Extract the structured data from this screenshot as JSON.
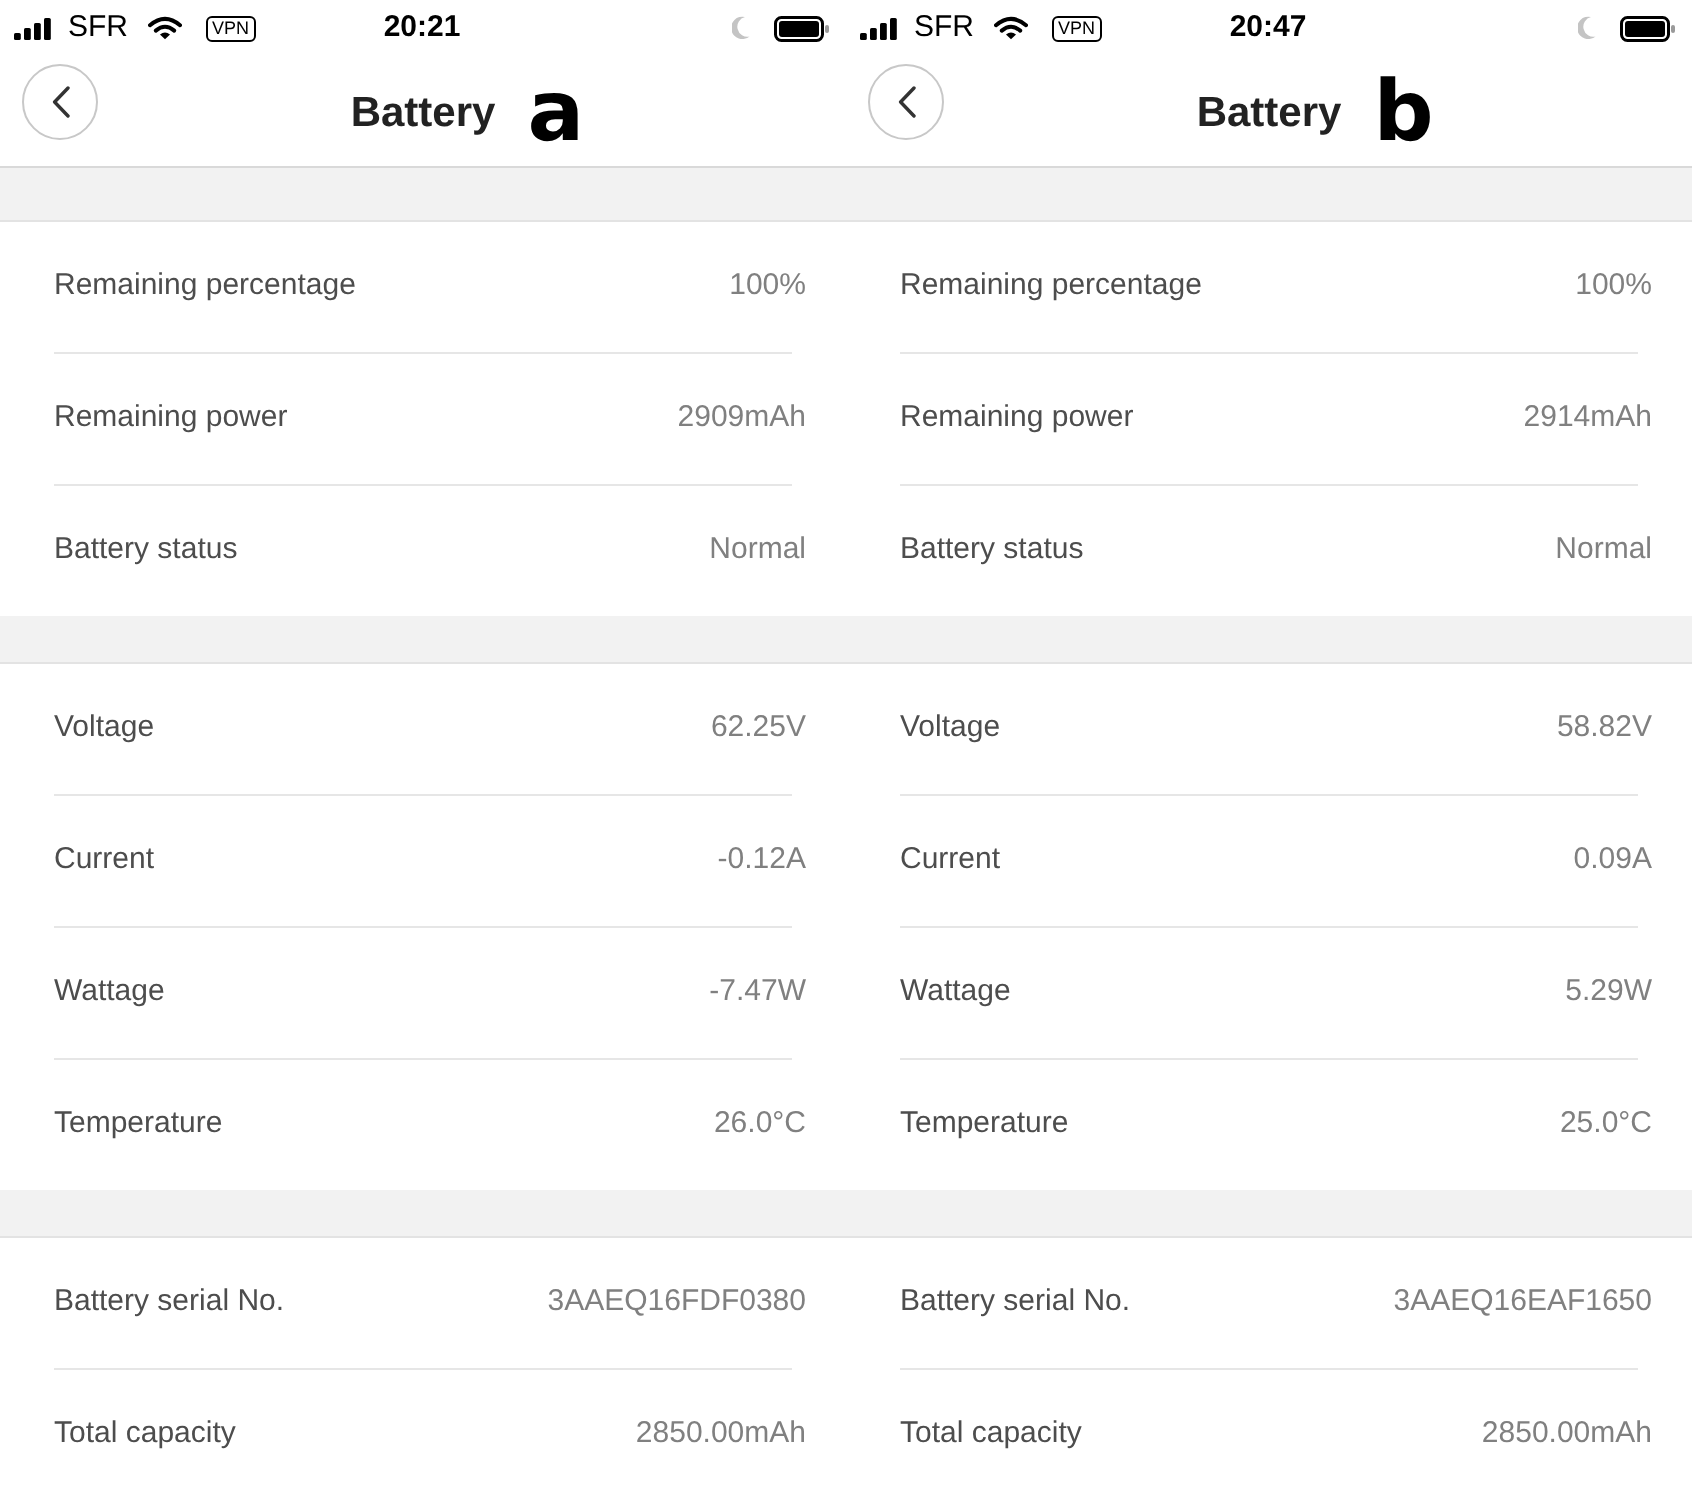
{
  "screens": [
    {
      "status_bar": {
        "carrier": "SFR",
        "vpn": "VPN",
        "time": "20:21"
      },
      "header": {
        "title": "Battery",
        "annotation": "a"
      },
      "groups": [
        {
          "rows": [
            {
              "label": "Remaining percentage",
              "value": "100%"
            },
            {
              "label": "Remaining power",
              "value": "2909mAh"
            },
            {
              "label": "Battery status",
              "value": "Normal"
            }
          ]
        },
        {
          "rows": [
            {
              "label": "Voltage",
              "value": "62.25V"
            },
            {
              "label": "Current",
              "value": "-0.12A"
            },
            {
              "label": "Wattage",
              "value": "-7.47W"
            },
            {
              "label": "Temperature",
              "value": "26.0°C"
            }
          ]
        },
        {
          "rows": [
            {
              "label": "Battery serial No.",
              "value": "3AAEQ16FDF0380"
            },
            {
              "label": "Total capacity",
              "value": "2850.00mAh"
            }
          ]
        }
      ]
    },
    {
      "status_bar": {
        "carrier": "SFR",
        "vpn": "VPN",
        "time": "20:47"
      },
      "header": {
        "title": "Battery",
        "annotation": "b"
      },
      "groups": [
        {
          "rows": [
            {
              "label": "Remaining percentage",
              "value": "100%"
            },
            {
              "label": "Remaining power",
              "value": "2914mAh"
            },
            {
              "label": "Battery status",
              "value": "Normal"
            }
          ]
        },
        {
          "rows": [
            {
              "label": "Voltage",
              "value": "58.82V"
            },
            {
              "label": "Current",
              "value": "0.09A"
            },
            {
              "label": "Wattage",
              "value": "5.29W"
            },
            {
              "label": "Temperature",
              "value": "25.0°C"
            }
          ]
        },
        {
          "rows": [
            {
              "label": "Battery serial No.",
              "value": "3AAEQ16EAF1650"
            },
            {
              "label": "Total capacity",
              "value": "2850.00mAh"
            }
          ]
        }
      ]
    }
  ]
}
